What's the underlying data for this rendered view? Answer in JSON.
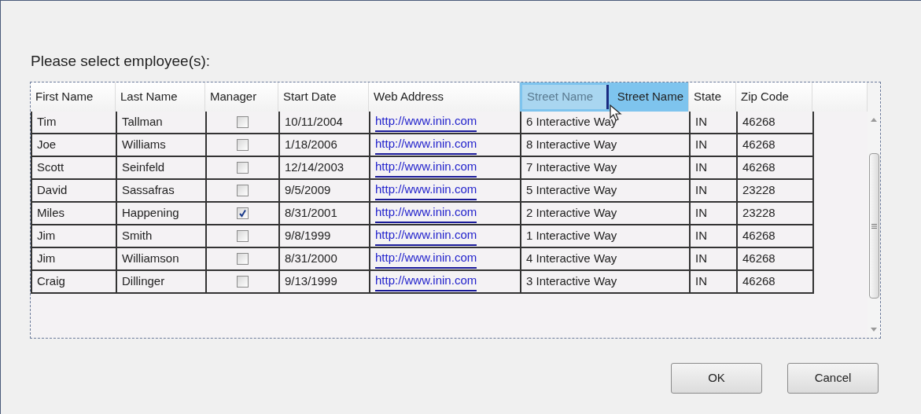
{
  "prompt": "Please select employee(s):",
  "grid": {
    "columns": [
      {
        "label": "First Name",
        "kind": "text",
        "dragging": false
      },
      {
        "label": "Last Name",
        "kind": "text",
        "dragging": false
      },
      {
        "label": "Manager",
        "kind": "check",
        "dragging": false
      },
      {
        "label": "Start Date",
        "kind": "text",
        "dragging": false
      },
      {
        "label": "Web Address",
        "kind": "link",
        "dragging": false
      },
      {
        "label": "Street Name",
        "kind": "text",
        "dragging": true
      },
      {
        "label": "State",
        "kind": "text",
        "dragging": false
      },
      {
        "label": "Zip Code",
        "kind": "text",
        "dragging": false
      }
    ],
    "drag_ghost": "Street Name",
    "rows": [
      {
        "cells": [
          "Tim",
          "Tallman",
          {
            "checked": false
          },
          "10/11/2004",
          "http://www.inin.com",
          "6 Interactive Way",
          "IN",
          "46268"
        ]
      },
      {
        "cells": [
          "Joe",
          "Williams",
          {
            "checked": false
          },
          "1/18/2006",
          "http://www.inin.com",
          "8 Interactive Way",
          "IN",
          "46268"
        ]
      },
      {
        "cells": [
          "Scott",
          "Seinfeld",
          {
            "checked": false
          },
          "12/14/2003",
          "http://www.inin.com",
          "7 Interactive Way",
          "IN",
          "46268"
        ]
      },
      {
        "cells": [
          "David",
          "Sassafras",
          {
            "checked": false
          },
          "9/5/2009",
          "http://www.inin.com",
          "5 Interactive Way",
          "IN",
          "23228"
        ]
      },
      {
        "cells": [
          "Miles",
          "Happening",
          {
            "checked": true
          },
          "8/31/2001",
          "http://www.inin.com",
          "2 Interactive Way",
          "IN",
          "23228"
        ]
      },
      {
        "cells": [
          "Jim",
          "Smith",
          {
            "checked": false
          },
          "9/8/1999",
          "http://www.inin.com",
          "1 Interactive Way",
          "IN",
          "46268"
        ]
      },
      {
        "cells": [
          "Jim",
          "Williamson",
          {
            "checked": false
          },
          "8/31/2000",
          "http://www.inin.com",
          "4 Interactive Way",
          "IN",
          "46268"
        ]
      },
      {
        "cells": [
          "Craig",
          "Dillinger",
          {
            "checked": false
          },
          "9/13/1999",
          "http://www.inin.com",
          "3 Interactive Way",
          "IN",
          "46268"
        ]
      }
    ]
  },
  "buttons": [
    "OK",
    "Cancel"
  ]
}
